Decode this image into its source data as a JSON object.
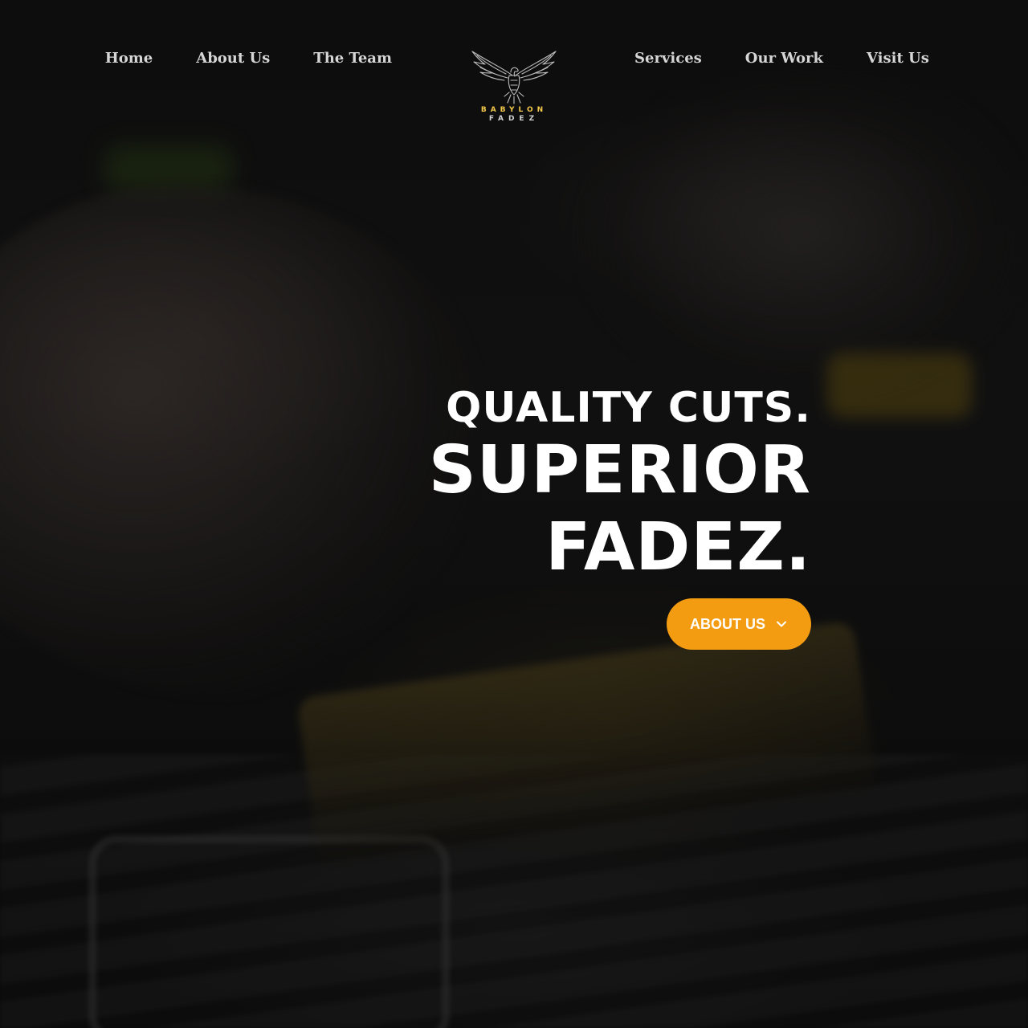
{
  "nav": {
    "left": [
      {
        "label": "Home"
      },
      {
        "label": "About Us"
      },
      {
        "label": "The Team"
      }
    ],
    "right": [
      {
        "label": "Services"
      },
      {
        "label": "Our Work"
      },
      {
        "label": "Visit Us"
      }
    ]
  },
  "logo": {
    "top": "BABYLON",
    "bottom": "FADEZ",
    "icon": "eagle-icon"
  },
  "hero": {
    "line1": "QUALITY CUTS.",
    "line2": "SUPERIOR",
    "line3": "FADEZ.",
    "cta_label": "ABOUT US",
    "cta_icon": "chevron-down-icon"
  },
  "colors": {
    "accent": "#f39c12",
    "logo_gold": "#f2c94c",
    "text": "#ffffff",
    "nav_text": "#d6d6d6"
  }
}
